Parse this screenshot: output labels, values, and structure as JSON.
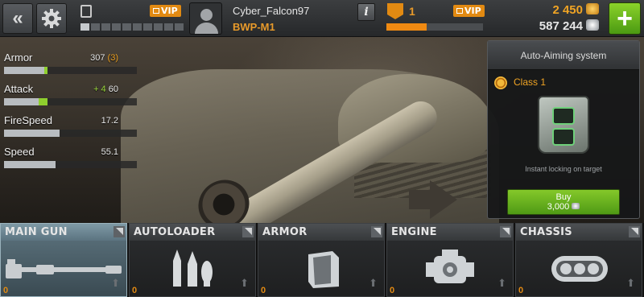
{
  "topbar": {
    "back_icon": "double-chevron-left-icon",
    "settings_icon": "gear-icon",
    "garage_icon": "garage-door-icon",
    "vip_label": "VIP",
    "level_segments_total": 10,
    "level_segments_filled": 1,
    "player_name": "Cyber_Falcon97",
    "tank_name": "BWP-M1",
    "info_label": "i",
    "rank_value": "1",
    "rank_vip_label": "VIP",
    "rank_progress": 0.42,
    "gold": "2 450",
    "silver": "587 244",
    "add_label": "+"
  },
  "stats": [
    {
      "label": "Armor",
      "value": "307",
      "bonus": "(3)",
      "bonus_color": "#f0a424",
      "fill": 0.3,
      "ext": 0.03
    },
    {
      "label": "Attack",
      "value": "60",
      "bonus": "+ 4",
      "bonus_color": "#9bd93c",
      "fill": 0.26,
      "ext": 0.07
    },
    {
      "label": "FireSpeed",
      "value": "17.2",
      "bonus": "",
      "bonus_color": "#9bd93c",
      "fill": 0.42,
      "ext": 0
    },
    {
      "label": "Speed",
      "value": "55.1",
      "bonus": "",
      "bonus_color": "#9bd93c",
      "fill": 0.39,
      "ext": 0
    }
  ],
  "module_panel": {
    "title": "Auto-Aiming system",
    "class_label": "Class 1",
    "description": "Instant locking on target",
    "buy_label": "Buy",
    "price": "3,000",
    "module_icon": "targeting-computer-icon"
  },
  "tabs": [
    {
      "label": "MAIN GUN",
      "count": "0",
      "active": true,
      "icon": "cannon-icon"
    },
    {
      "label": "AUTOLOADER",
      "count": "0",
      "active": false,
      "icon": "shells-icon"
    },
    {
      "label": "ARMOR",
      "count": "0",
      "active": false,
      "icon": "armor-plate-icon"
    },
    {
      "label": "ENGINE",
      "count": "0",
      "active": false,
      "icon": "engine-icon"
    },
    {
      "label": "CHASSIS",
      "count": "0",
      "active": false,
      "icon": "track-icon"
    }
  ],
  "colors": {
    "accent_orange": "#e28a12",
    "accent_green": "#6cb61e"
  }
}
